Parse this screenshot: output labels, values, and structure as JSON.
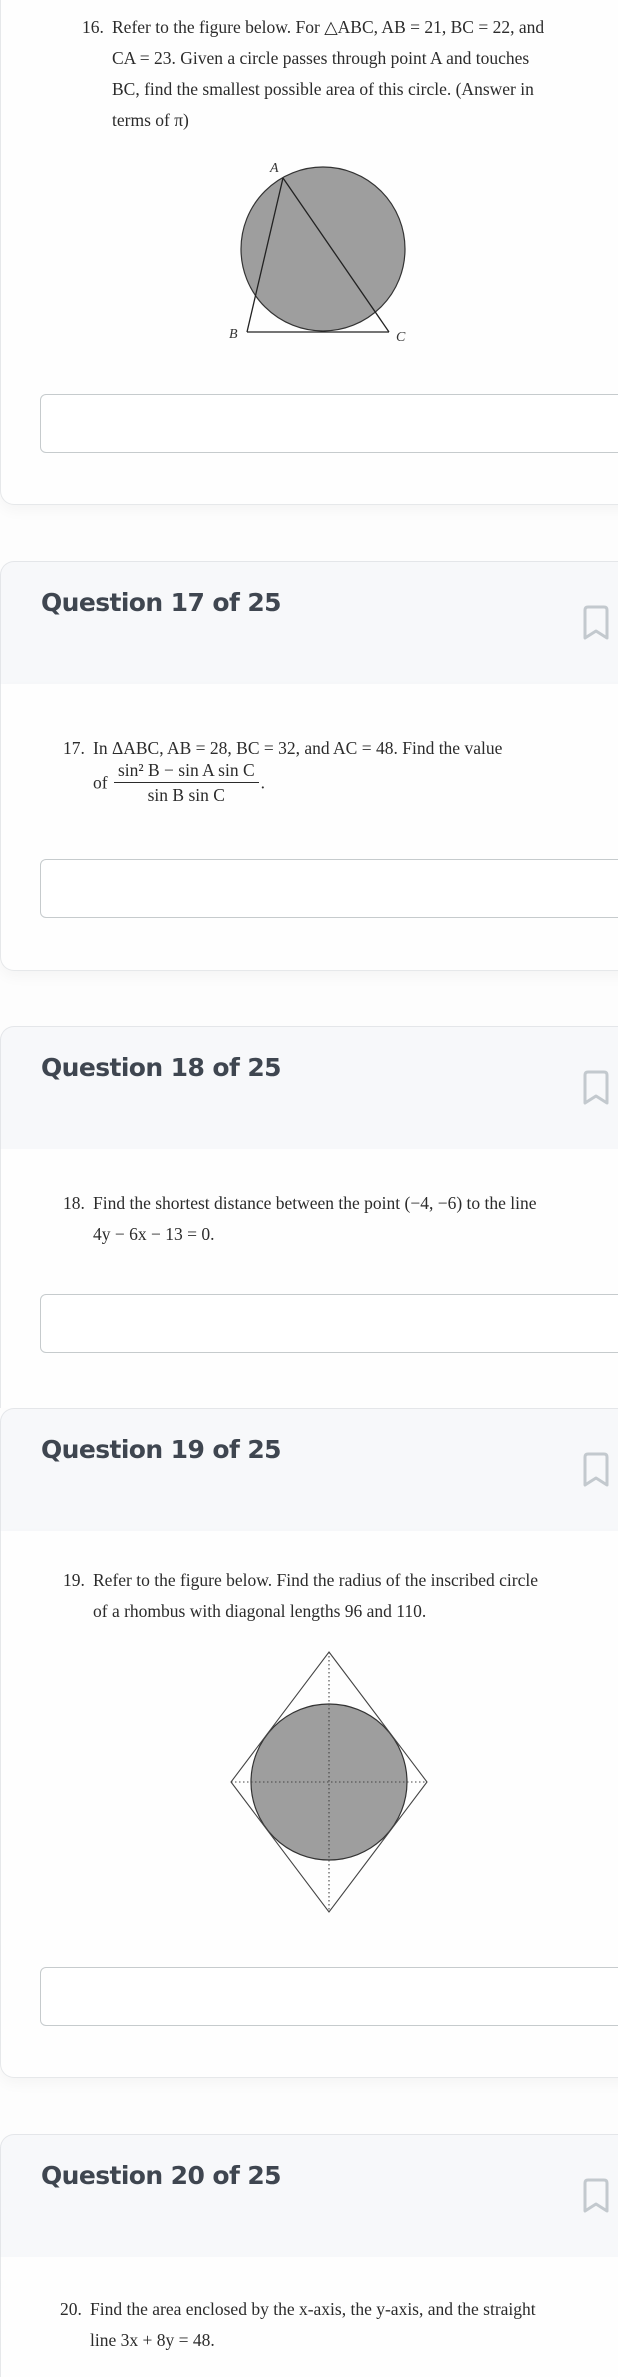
{
  "questions": [
    {
      "number": "16.",
      "header": null,
      "lines": [
        "Refer to the figure below.  For △ABC, AB = 21, BC = 22, and",
        "CA = 23.  Given a circle passes through point A and touches",
        "BC, find the smallest possible area of this circle.  (Answer in",
        "terms of π)"
      ],
      "figure": {
        "type": "triangle-with-tangent-circle",
        "labels": {
          "A": "A",
          "B": "B",
          "C": "C"
        }
      },
      "answer": {
        "value": "",
        "placeholder": ""
      }
    },
    {
      "number": "17.",
      "header": "Question 17 of 25",
      "lines": [
        "In ΔABC, AB = 28, BC = 32, and AC = 48.  Find the value",
        "of"
      ],
      "fraction": {
        "numerator": "sin² B − sin A sin C",
        "denominator": "sin B sin C"
      },
      "answer": {
        "value": "",
        "placeholder": ""
      }
    },
    {
      "number": "18.",
      "header": "Question 18 of 25",
      "lines": [
        "Find the shortest distance between the point (−4, −6) to the line",
        "4y − 6x − 13 = 0."
      ],
      "answer": {
        "value": "",
        "placeholder": ""
      }
    },
    {
      "number": "19.",
      "header": "Question 19 of 25",
      "lines": [
        "Refer to the figure below.  Find the radius of the inscribed circle",
        "of a rhombus with diagonal lengths 96 and 110."
      ],
      "figure": {
        "type": "rhombus-with-inscribed-circle"
      },
      "answer": {
        "value": "",
        "placeholder": ""
      }
    },
    {
      "number": "20.",
      "header": "Question 20 of 25",
      "lines": [
        "Find the area enclosed by the x-axis, the y-axis, and the straight",
        "line 3x + 8y = 48."
      ]
    }
  ],
  "icons": {
    "bookmark": "bookmark-outline-icon"
  },
  "colors": {
    "header_bg": "#f7f8fa",
    "header_text": "#3f4650",
    "bookmark": "#c3c9ce",
    "figure_fill": "#9e9e9e",
    "input_border": "#c6cbcd"
  }
}
